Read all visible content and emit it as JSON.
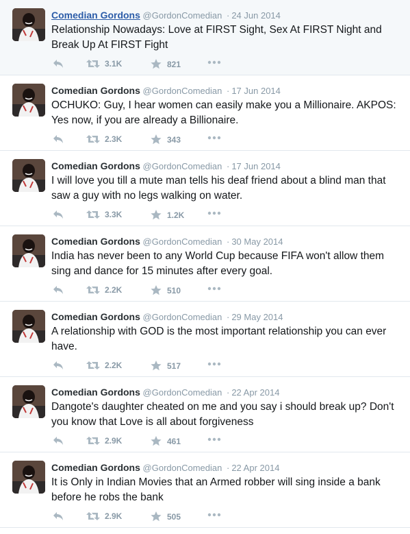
{
  "tweets": [
    {
      "name": "Comedian Gordons",
      "handle": "@GordonComedian",
      "separator": "·",
      "date": "24 Jun 2014",
      "text": "Relationship Nowadays: Love at FIRST Sight, Sex At FIRST Night and Break Up At FIRST Fight",
      "retweets": "3.1K",
      "favorites": "821"
    },
    {
      "name": "Comedian Gordons",
      "handle": "@GordonComedian",
      "separator": "·",
      "date": "17 Jun 2014",
      "text": "OCHUKO: Guy, I hear women can easily make you a Millionaire. AKPOS: Yes now, if you are already a Billionaire.",
      "retweets": "2.3K",
      "favorites": "343"
    },
    {
      "name": "Comedian Gordons",
      "handle": "@GordonComedian",
      "separator": "·",
      "date": "17 Jun 2014",
      "text": "I will love you till a mute man tells his deaf friend about a blind man that saw a guy with no legs walking on water.",
      "retweets": "3.3K",
      "favorites": "1.2K"
    },
    {
      "name": "Comedian Gordons",
      "handle": "@GordonComedian",
      "separator": "·",
      "date": "30 May 2014",
      "text": "India has never been to any World Cup because FIFA won't allow them sing and dance for 15 minutes after every goal.",
      "retweets": "2.2K",
      "favorites": "510"
    },
    {
      "name": "Comedian Gordons",
      "handle": "@GordonComedian",
      "separator": "·",
      "date": "29 May 2014",
      "text": "A relationship with GOD is the most important relationship you can ever have.",
      "retweets": "2.2K",
      "favorites": "517"
    },
    {
      "name": "Comedian Gordons",
      "handle": "@GordonComedian",
      "separator": "·",
      "date": "22 Apr 2014",
      "text": "Dangote's daughter cheated on me and you say i should break up? Don't you know that Love is all about forgiveness",
      "retweets": "2.9K",
      "favorites": "461"
    },
    {
      "name": "Comedian Gordons",
      "handle": "@GordonComedian",
      "separator": "·",
      "date": "22 Apr 2014",
      "text": "It is Only in Indian Movies that an Armed robber will sing inside a bank before he robs the bank",
      "retweets": "2.9K",
      "favorites": "505"
    }
  ],
  "icons": {
    "reply": "reply-icon",
    "retweet": "retweet-icon",
    "favorite": "star-icon",
    "more": "more-options-icon",
    "avatar": "profile-photo"
  },
  "colors": {
    "name_link": "#2b5ca8",
    "muted": "#8899a6",
    "text": "#14171a",
    "divider": "#e1e8ed",
    "first_bg": "#f5f8fa"
  }
}
